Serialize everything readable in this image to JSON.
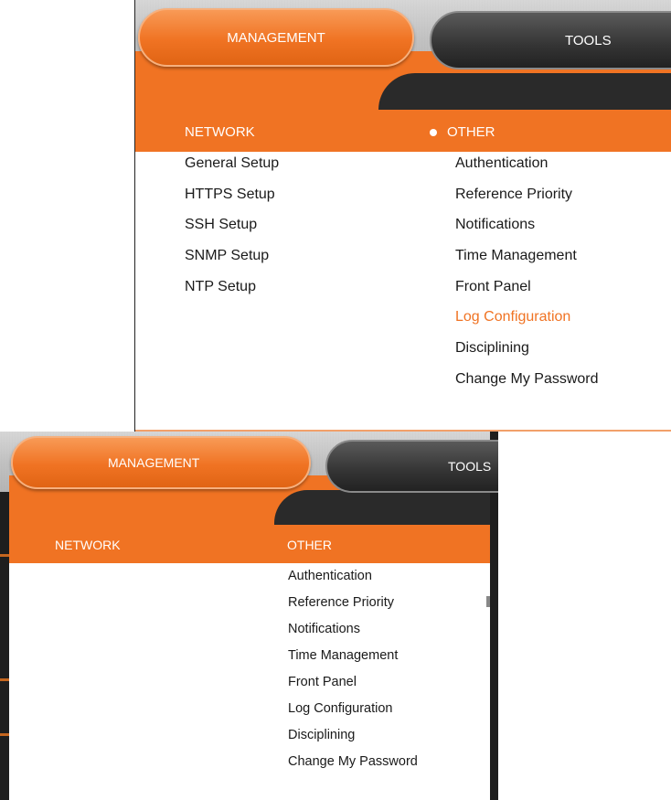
{
  "top_panel": {
    "tabs": {
      "management": "MANAGEMENT",
      "tools": "TOOLS"
    },
    "headers": {
      "network": "NETWORK",
      "other": "OTHER"
    },
    "network_items": [
      "General Setup",
      "HTTPS Setup",
      "SSH Setup",
      "SNMP Setup",
      "NTP Setup"
    ],
    "other_items": [
      "Authentication",
      "Reference Priority",
      "Notifications",
      "Time Management",
      "Front Panel",
      "Log Configuration",
      "Disciplining",
      "Change My Password"
    ],
    "active_item": "Log Configuration"
  },
  "bottom_panel": {
    "tabs": {
      "management": "MANAGEMENT",
      "tools": "TOOLS"
    },
    "headers": {
      "network": "NETWORK",
      "other": "OTHER"
    },
    "other_items": [
      "Authentication",
      "Reference Priority",
      "Notifications",
      "Time Management",
      "Front Panel",
      "Log Configuration",
      "Disciplining",
      "Change My Password"
    ]
  },
  "colors": {
    "accent_orange": "#f07323",
    "dark_tab": "#343434",
    "active_text": "#f07323"
  }
}
